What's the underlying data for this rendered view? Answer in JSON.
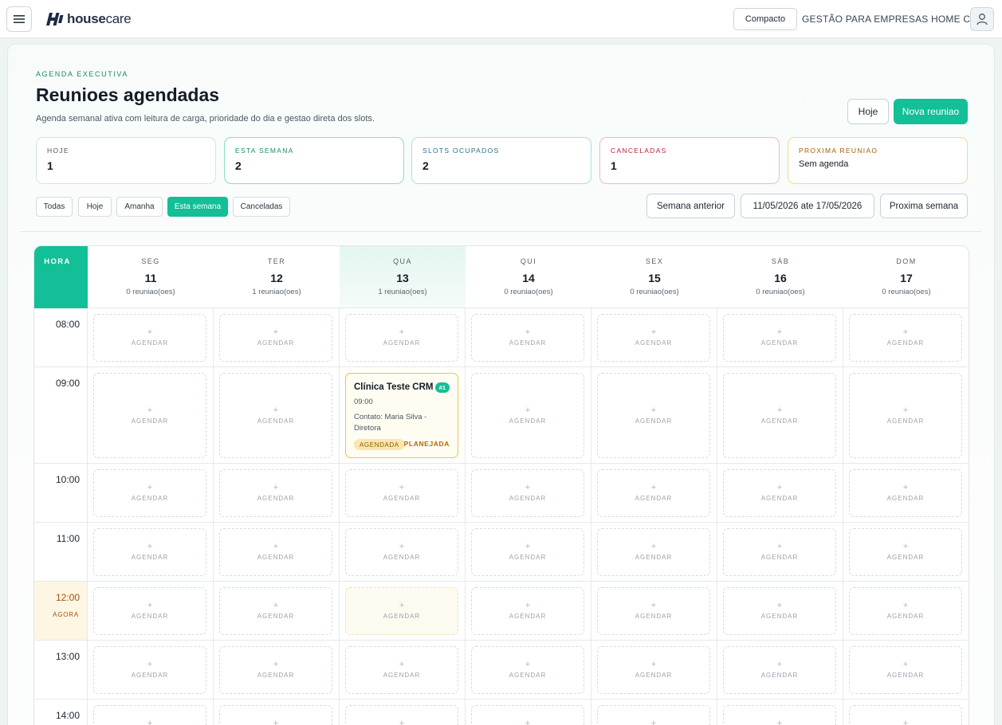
{
  "header": {
    "brand_prefix": "house",
    "brand_suffix": "care",
    "compact_label": "Compacto",
    "company": "GESTÃO PARA EMPRESAS HOME CARE"
  },
  "page": {
    "eyebrow": "AGENDA EXECUTIVA",
    "title": "Reunioes agendadas",
    "subtitle": "Agenda semanal ativa com leitura de carga, prioridade do dia e gestao direta dos slots.",
    "today_button": "Hoje",
    "new_button": "Nova reuniao"
  },
  "stats": [
    {
      "label": "HOJE",
      "value": "1",
      "color": "#d9e0e6",
      "label_color": "#4b5765"
    },
    {
      "label": "ESTA SEMANA",
      "value": "2",
      "color": "#8fdcc6",
      "label_color": "#1c8a6d"
    },
    {
      "label": "SLOTS OCUPADOS",
      "value": "2",
      "color": "#a9dcef",
      "label_color": "#2a6f8a"
    },
    {
      "label": "CANCELADAS",
      "value": "1",
      "color": "#f0b9c2",
      "label_color": "#b3263c"
    },
    {
      "label": "PROXIMA REUNIAO",
      "value": "Sem agenda",
      "color": "#f2d98a",
      "label_color": "#a05f00"
    }
  ],
  "filters": [
    "Todas",
    "Hoje",
    "Amanha",
    "Esta semana",
    "Canceladas"
  ],
  "active_filter": "Esta semana",
  "week_nav": {
    "prev": "Semana anterior",
    "range": "11/05/2026 ate 17/05/2026",
    "next": "Proxima semana"
  },
  "calendar": {
    "hour_label": "HORA",
    "now_tag": "AGORA",
    "slot_plus": "+",
    "slot_label": "AGENDAR",
    "days": [
      {
        "name": "SEG",
        "num": "11",
        "count": "0 reuniao(oes)"
      },
      {
        "name": "TER",
        "num": "12",
        "count": "1 reuniao(oes)"
      },
      {
        "name": "QUA",
        "num": "13",
        "count": "1 reuniao(oes)"
      },
      {
        "name": "QUI",
        "num": "14",
        "count": "0 reuniao(oes)"
      },
      {
        "name": "SEX",
        "num": "15",
        "count": "0 reuniao(oes)"
      },
      {
        "name": "SÁB",
        "num": "16",
        "count": "0 reuniao(oes)"
      },
      {
        "name": "DOM",
        "num": "17",
        "count": "0 reuniao(oes)"
      }
    ],
    "hours": [
      "08:00",
      "09:00",
      "10:00",
      "11:00",
      "12:00",
      "13:00",
      "14:00"
    ],
    "event": {
      "title": "Clínica Teste CRM",
      "badge": "#1",
      "time": "09:00",
      "contact": "Contato: Maria Silva - Diretora",
      "status": "AGENDADA",
      "phase": "PLANEJADA"
    }
  },
  "colors": {
    "accent": "#12bf97",
    "event_border": "#f0c540",
    "now_bg": "#fdf6e3"
  }
}
